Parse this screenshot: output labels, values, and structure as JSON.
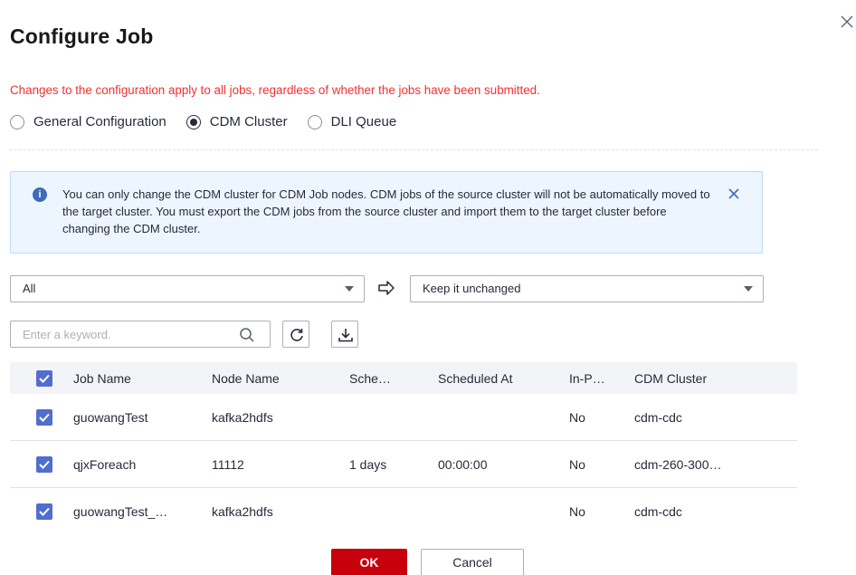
{
  "dialog": {
    "title": "Configure Job",
    "close_icon": "close-icon"
  },
  "warning_text": "Changes to the configuration apply to all jobs, regardless of whether the jobs have been submitted.",
  "radio_options": [
    {
      "label": "General Configuration",
      "checked": false
    },
    {
      "label": "CDM Cluster",
      "checked": true
    },
    {
      "label": "DLI Queue",
      "checked": false
    }
  ],
  "info": {
    "icon": "info-icon",
    "text": "You can only change the CDM cluster for CDM Job nodes. CDM jobs of the source cluster will not be automatically moved to the target cluster. You must export the CDM jobs from the source cluster and import them to the target cluster before changing the CDM cluster.",
    "close_icon": "close-icon",
    "accent_color": "#3f6bbb"
  },
  "source_select": {
    "value": "All"
  },
  "target_select": {
    "value": "Keep it unchanged"
  },
  "search": {
    "placeholder": "Enter a keyword."
  },
  "table": {
    "columns": [
      "Job Name",
      "Node Name",
      "Sche…",
      "Scheduled At",
      "In-P…",
      "CDM Cluster"
    ],
    "rows": [
      {
        "checked": true,
        "job_name": "guowangTest",
        "node_name": "kafka2hdfs",
        "schedule": "",
        "scheduled_at": "",
        "in_progress": "No",
        "cdm_cluster": "cdm-cdc"
      },
      {
        "checked": true,
        "job_name": "qjxForeach",
        "node_name": "11112",
        "schedule": "1 days",
        "scheduled_at": "00:00:00",
        "in_progress": "No",
        "cdm_cluster": "cdm-260-300…"
      },
      {
        "checked": true,
        "job_name": "guowangTest_…",
        "node_name": "kafka2hdfs",
        "schedule": "",
        "scheduled_at": "",
        "in_progress": "No",
        "cdm_cluster": "cdm-cdc"
      }
    ]
  },
  "buttons": {
    "ok": "OK",
    "cancel": "Cancel"
  },
  "colors": {
    "warning": "#f62f2f",
    "ok_button": "#c7000b",
    "checkbox": "#526ecc",
    "info_bg": "#edf5ff"
  }
}
